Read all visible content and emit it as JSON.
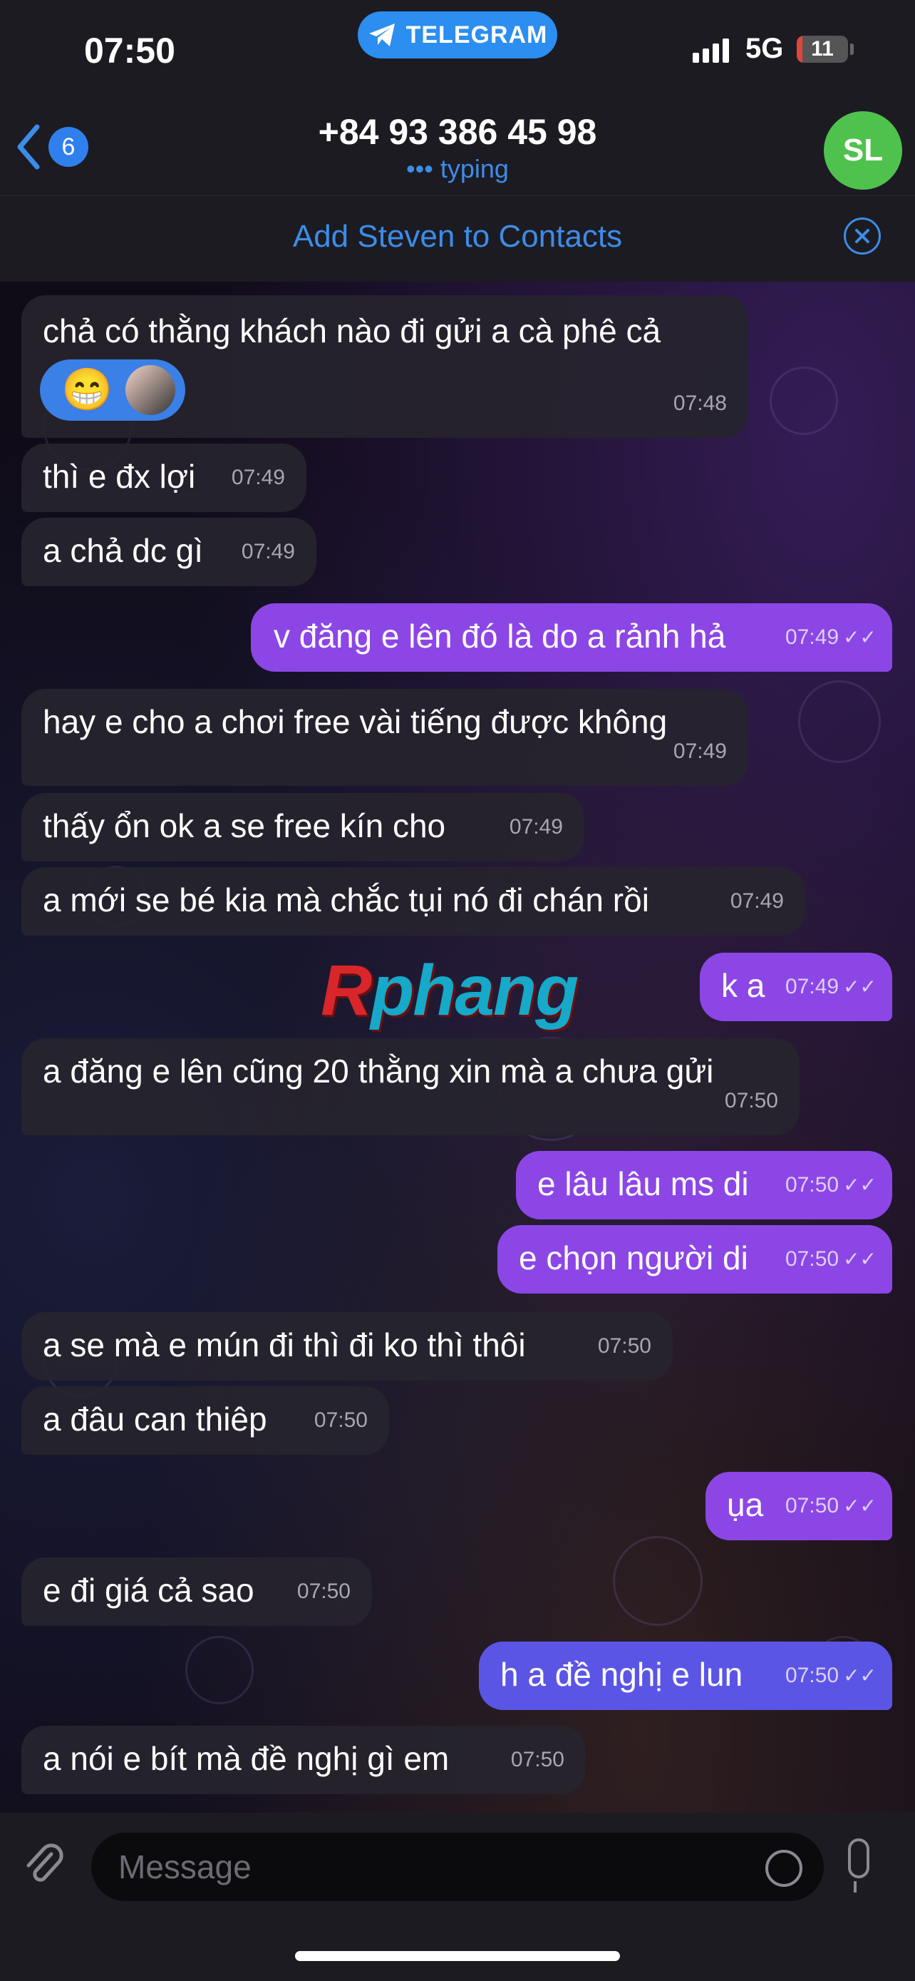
{
  "status_bar": {
    "time": "07:50",
    "network": "5G",
    "battery": "11",
    "battery_level": 0.11
  },
  "pill": {
    "label": "TELEGRAM"
  },
  "header": {
    "back_count": "6",
    "title": "+84 93 386 45 98",
    "subtitle": "••• typing",
    "avatar_initials": "SL"
  },
  "contact_bar": {
    "label": "Add Steven to Contacts"
  },
  "watermark": {
    "first": "R",
    "rest": "phang"
  },
  "messages": [
    {
      "text": "chả có thằng khách nào đi gửi a cà phê cả",
      "time": "07:48"
    },
    {
      "text": "thì e đx lợi",
      "time": "07:49"
    },
    {
      "text": "a chả dc gì",
      "time": "07:49"
    },
    {
      "text": "v đăng e lên đó là do a rảnh hả",
      "time": "07:49"
    },
    {
      "text": "hay e cho a chơi free vài tiếng được không",
      "time": "07:49"
    },
    {
      "text": "thấy ổn ok a se free kín cho",
      "time": "07:49"
    },
    {
      "text": "a mới se bé kia mà chắc tụi nó đi chán rồi",
      "time": "07:49"
    },
    {
      "text": "k a",
      "time": "07:49"
    },
    {
      "text": "a đăng e lên cũng 20 thằng xin mà a chưa gửi",
      "time": "07:50"
    },
    {
      "text": "e lâu lâu ms di",
      "time": "07:50"
    },
    {
      "text": "e chọn người di",
      "time": "07:50"
    },
    {
      "text": "a se mà e mún đi thì đi ko thì thôi",
      "time": "07:50"
    },
    {
      "text": "a đâu can thiêp",
      "time": "07:50"
    },
    {
      "text": "ụa",
      "time": "07:50"
    },
    {
      "text": "e đi giá cả sao",
      "time": "07:50"
    },
    {
      "text": "h a đề nghị e lun",
      "time": "07:50"
    },
    {
      "text": "a nói e bít mà đề nghị gì em",
      "time": "07:50"
    }
  ],
  "composer": {
    "placeholder": "Message"
  },
  "colors": {
    "accent": "#3d8ce8",
    "outgoing": "#8c46e6",
    "incoming": "#26242e",
    "avatar": "#4fc24d"
  }
}
